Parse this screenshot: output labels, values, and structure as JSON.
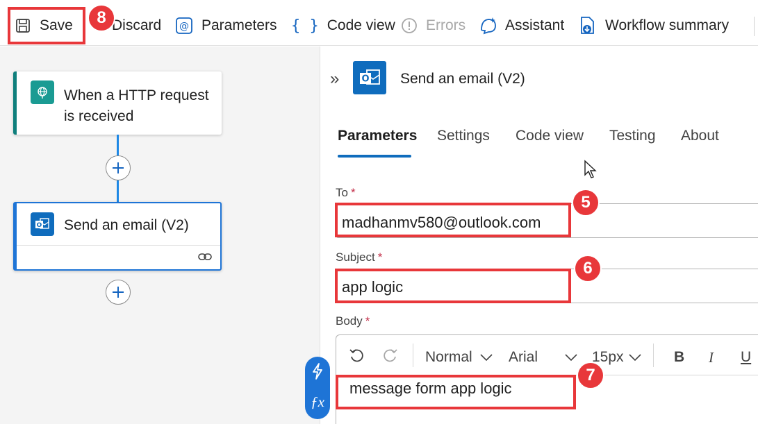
{
  "toolbar": {
    "save_label": "Save",
    "discard_label": "Discard",
    "parameters_label": "Parameters",
    "code_view_label": "Code view",
    "errors_label": "Errors",
    "assistant_label": "Assistant",
    "workflow_summary_label": "Workflow summary"
  },
  "canvas": {
    "trigger_title_line1": "When a HTTP request",
    "trigger_title_line2": "is received",
    "action_title": "Send an email (V2)",
    "connector_color": "#1e88e5"
  },
  "panel": {
    "title": "Send an email (V2)",
    "tabs": [
      "Parameters",
      "Settings",
      "Code view",
      "Testing",
      "About"
    ],
    "active_tab": "Parameters",
    "to": {
      "label": "To",
      "required": "*",
      "value": "madhanmv580@outlook.com"
    },
    "subject": {
      "label": "Subject",
      "required": "*",
      "value": "app logic"
    },
    "body": {
      "label": "Body",
      "required": "*",
      "value": "message form app logic",
      "font_style": "Normal",
      "font_family": "Arial",
      "font_size": "15px",
      "bold_label": "B",
      "italic_label": "I",
      "underline_label": "U"
    }
  },
  "annotations": {
    "badge_save": "8",
    "badge_to": "5",
    "badge_subject": "6",
    "badge_body": "7",
    "highlight_color": "#e8373a"
  }
}
